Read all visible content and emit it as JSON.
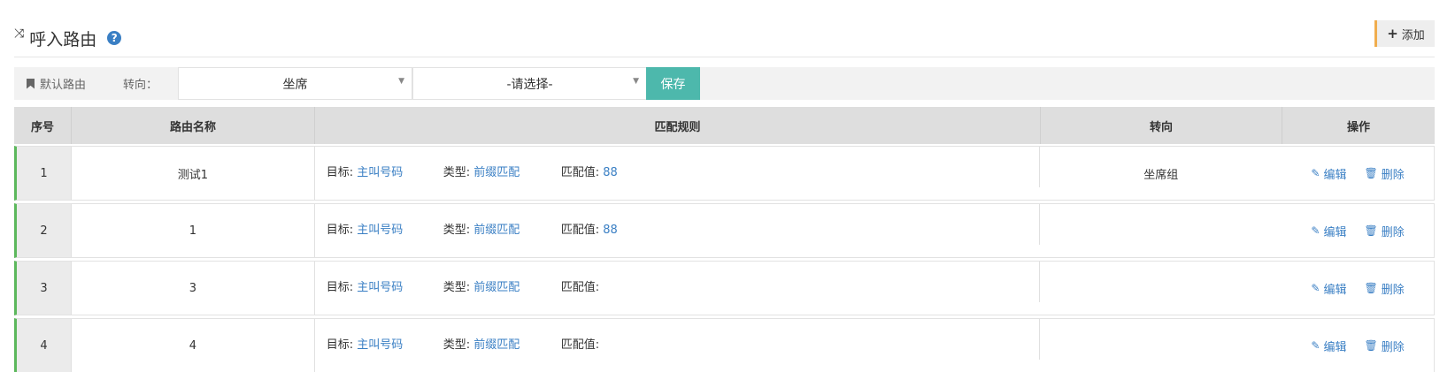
{
  "header": {
    "title": "呼入路由",
    "add_label": "添加"
  },
  "toolbar": {
    "default_route_label": "默认路由",
    "turn_label": "转向：",
    "select_primary": "坐席",
    "select_secondary": "-请选择-",
    "save_label": "保存"
  },
  "table": {
    "columns": [
      "序号",
      "路由名称",
      "匹配规则",
      "转向",
      "操作"
    ],
    "rule_labels": {
      "target": "目标:",
      "type": "类型:",
      "match": "匹配值:"
    },
    "actions": {
      "edit": "编辑",
      "delete": "删除"
    },
    "rows": [
      {
        "seq": "1",
        "name": "测试1",
        "target": "主叫号码",
        "type": "前缀匹配",
        "match": "88",
        "turn": "坐席组"
      },
      {
        "seq": "2",
        "name": "1",
        "target": "主叫号码",
        "type": "前缀匹配",
        "match": "88",
        "turn": ""
      },
      {
        "seq": "3",
        "name": "3",
        "target": "主叫号码",
        "type": "前缀匹配",
        "match": "",
        "turn": ""
      },
      {
        "seq": "4",
        "name": "4",
        "target": "主叫号码",
        "type": "前缀匹配",
        "match": "",
        "turn": ""
      }
    ]
  },
  "colors": {
    "accent_green": "#5cb85c",
    "save_button": "#4db8ac",
    "link_blue": "#3a7fc4",
    "add_accent": "#f0ad4e"
  },
  "icons": [
    "shuffle-icon",
    "help-icon",
    "plus-icon",
    "bookmark-icon",
    "caret-down-icon",
    "edit-icon",
    "trash-icon"
  ]
}
